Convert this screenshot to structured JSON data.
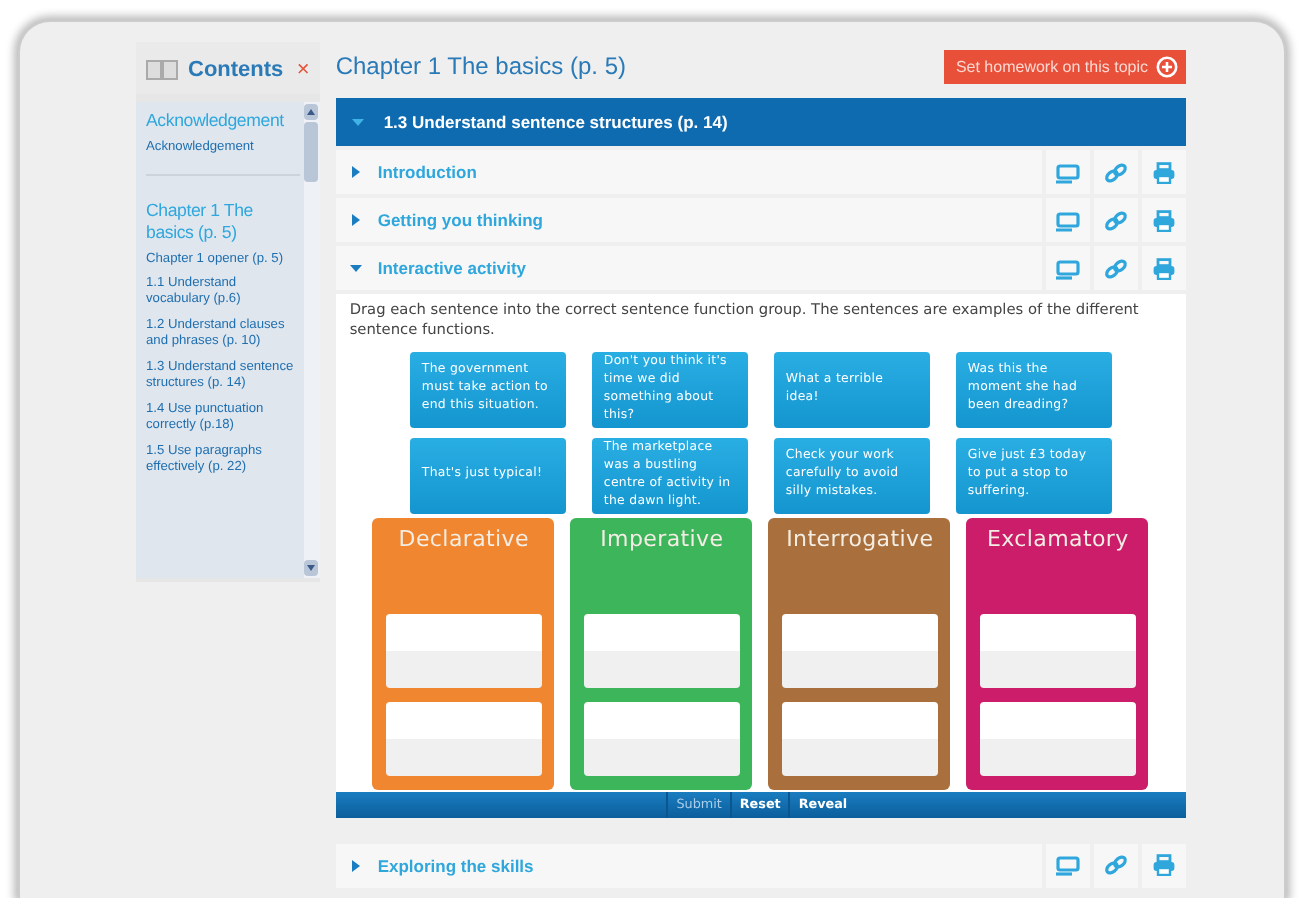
{
  "sidebar": {
    "title": "Contents",
    "close": "×",
    "groups": [
      {
        "heading": "Acknowledgement",
        "items": [
          "Acknowledgement"
        ]
      },
      {
        "heading": "Chapter 1 The basics (p. 5)",
        "items": [
          "Chapter 1 opener (p. 5)",
          "1.1 Understand vocabulary (p.6)",
          "1.2 Understand clauses and phrases (p. 10)",
          "1.3 Understand sentence structures (p. 14)",
          "1.4 Use punctuation correctly (p.18)",
          "1.5 Use paragraphs effectively (p. 22)"
        ]
      }
    ]
  },
  "main": {
    "title": "Chapter 1 The basics (p. 5)",
    "homework_button": "Set homework on this topic",
    "topic": {
      "label": "1.3 Understand sentence structures (p. 14)",
      "expanded": true
    },
    "sections": [
      {
        "label": "Introduction",
        "expanded": false
      },
      {
        "label": "Getting you thinking",
        "expanded": false
      },
      {
        "label": "Interactive activity",
        "expanded": true,
        "activity": {
          "instruction": "Drag each sentence into the correct sentence function group. The sentences are examples of the different sentence functions.",
          "sentences": [
            "The government must take action to end this situation.",
            "Don't you think it's time we did something about this?",
            "What a terrible idea!",
            "Was this the moment she had been dreading?",
            "That's just typical!",
            "The marketplace was a bustling centre of activity in the dawn light.",
            "Check your work carefully to avoid silly mistakes.",
            "Give just £3 today to put a stop to suffering."
          ],
          "groups": [
            {
              "label": "Declarative",
              "color": "#f0862f"
            },
            {
              "label": "Imperative",
              "color": "#3db55a"
            },
            {
              "label": "Interrogative",
              "color": "#a9703d"
            },
            {
              "label": "Exclamatory",
              "color": "#cc1d6a"
            }
          ],
          "buttons": [
            {
              "label": "Submit",
              "disabled": true
            },
            {
              "label": "Reset",
              "disabled": false
            },
            {
              "label": "Reveal",
              "disabled": false
            }
          ]
        }
      },
      {
        "label": "Exploring the skills",
        "expanded": false
      }
    ]
  }
}
